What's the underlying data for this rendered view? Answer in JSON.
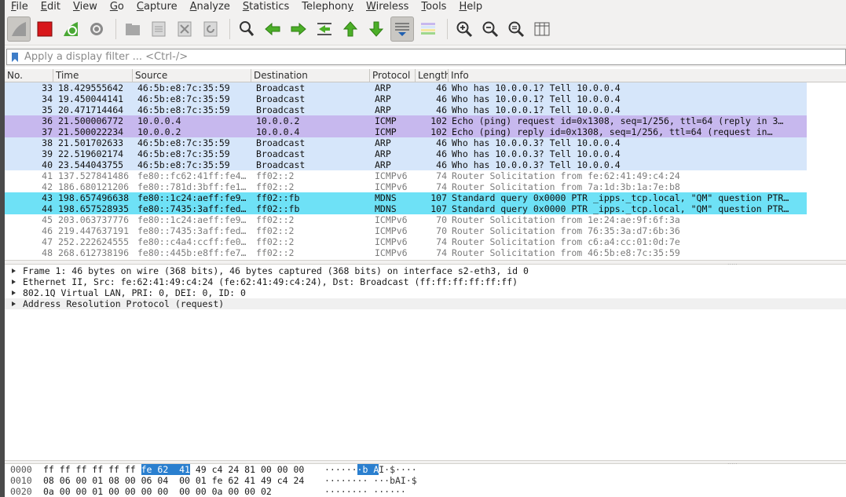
{
  "menu": [
    {
      "pre": "",
      "mn": "F",
      "post": "ile"
    },
    {
      "pre": "",
      "mn": "E",
      "post": "dit"
    },
    {
      "pre": "",
      "mn": "V",
      "post": "iew"
    },
    {
      "pre": "",
      "mn": "G",
      "post": "o"
    },
    {
      "pre": "",
      "mn": "C",
      "post": "apture"
    },
    {
      "pre": "",
      "mn": "A",
      "post": "nalyze"
    },
    {
      "pre": "",
      "mn": "S",
      "post": "tatistics"
    },
    {
      "pre": "Telephon",
      "mn": "y",
      "post": ""
    },
    {
      "pre": "",
      "mn": "W",
      "post": "ireless"
    },
    {
      "pre": "",
      "mn": "T",
      "post": "ools"
    },
    {
      "pre": "",
      "mn": "H",
      "post": "elp"
    }
  ],
  "filter": {
    "placeholder": "Apply a display filter ... <Ctrl-/>"
  },
  "columns": [
    "No.",
    "Time",
    "Source",
    "Destination",
    "Protocol",
    "Length",
    "Info"
  ],
  "colors": {
    "arp": "#d6e6fa",
    "icmp": "#c7b8ee",
    "mdns": "#6ee1f6",
    "white": "#ffffff",
    "grey_text": "#7c7c7c",
    "text": "#111111"
  },
  "packets": [
    {
      "no": "33",
      "time": "18.429555642",
      "src": "46:5b:e8:7c:35:59",
      "dst": "Broadcast",
      "proto": "ARP",
      "len": "46",
      "info": "Who has 10.0.0.1? Tell 10.0.0.4",
      "kind": "arp"
    },
    {
      "no": "34",
      "time": "19.450044141",
      "src": "46:5b:e8:7c:35:59",
      "dst": "Broadcast",
      "proto": "ARP",
      "len": "46",
      "info": "Who has 10.0.0.1? Tell 10.0.0.4",
      "kind": "arp"
    },
    {
      "no": "35",
      "time": "20.471714464",
      "src": "46:5b:e8:7c:35:59",
      "dst": "Broadcast",
      "proto": "ARP",
      "len": "46",
      "info": "Who has 10.0.0.1? Tell 10.0.0.4",
      "kind": "arp"
    },
    {
      "no": "36",
      "time": "21.500006772",
      "src": "10.0.0.4",
      "dst": "10.0.0.2",
      "proto": "ICMP",
      "len": "102",
      "info": "Echo (ping) request  id=0x1308, seq=1/256, ttl=64 (reply in 3…",
      "kind": "icmp"
    },
    {
      "no": "37",
      "time": "21.500022234",
      "src": "10.0.0.2",
      "dst": "10.0.0.4",
      "proto": "ICMP",
      "len": "102",
      "info": "Echo (ping) reply    id=0x1308, seq=1/256, ttl=64 (request in…",
      "kind": "icmp"
    },
    {
      "no": "38",
      "time": "21.501702633",
      "src": "46:5b:e8:7c:35:59",
      "dst": "Broadcast",
      "proto": "ARP",
      "len": "46",
      "info": "Who has 10.0.0.3? Tell 10.0.0.4",
      "kind": "arp"
    },
    {
      "no": "39",
      "time": "22.519602174",
      "src": "46:5b:e8:7c:35:59",
      "dst": "Broadcast",
      "proto": "ARP",
      "len": "46",
      "info": "Who has 10.0.0.3? Tell 10.0.0.4",
      "kind": "arp"
    },
    {
      "no": "40",
      "time": "23.544043755",
      "src": "46:5b:e8:7c:35:59",
      "dst": "Broadcast",
      "proto": "ARP",
      "len": "46",
      "info": "Who has 10.0.0.3? Tell 10.0.0.4",
      "kind": "arp"
    },
    {
      "no": "41",
      "time": "137.527841486",
      "src": "fe80::fc62:41ff:fe4…",
      "dst": "ff02::2",
      "proto": "ICMPv6",
      "len": "74",
      "info": "Router Solicitation from fe:62:41:49:c4:24",
      "kind": "white"
    },
    {
      "no": "42",
      "time": "186.680121206",
      "src": "fe80::781d:3bff:fe1…",
      "dst": "ff02::2",
      "proto": "ICMPv6",
      "len": "74",
      "info": "Router Solicitation from 7a:1d:3b:1a:7e:b8",
      "kind": "white"
    },
    {
      "no": "43",
      "time": "198.657496638",
      "src": "fe80::1c24:aeff:fe9…",
      "dst": "ff02::fb",
      "proto": "MDNS",
      "len": "107",
      "info": "Standard query 0x0000 PTR _ipps._tcp.local, \"QM\" question PTR…",
      "kind": "mdns"
    },
    {
      "no": "44",
      "time": "198.657528935",
      "src": "fe80::7435:3aff:fed…",
      "dst": "ff02::fb",
      "proto": "MDNS",
      "len": "107",
      "info": "Standard query 0x0000 PTR _ipps._tcp.local, \"QM\" question PTR…",
      "kind": "mdns"
    },
    {
      "no": "45",
      "time": "203.063737776",
      "src": "fe80::1c24:aeff:fe9…",
      "dst": "ff02::2",
      "proto": "ICMPv6",
      "len": "70",
      "info": "Router Solicitation from 1e:24:ae:9f:6f:3a",
      "kind": "white"
    },
    {
      "no": "46",
      "time": "219.447637191",
      "src": "fe80::7435:3aff:fed…",
      "dst": "ff02::2",
      "proto": "ICMPv6",
      "len": "70",
      "info": "Router Solicitation from 76:35:3a:d7:6b:36",
      "kind": "white"
    },
    {
      "no": "47",
      "time": "252.222624555",
      "src": "fe80::c4a4:ccff:fe0…",
      "dst": "ff02::2",
      "proto": "ICMPv6",
      "len": "74",
      "info": "Router Solicitation from c6:a4:cc:01:0d:7e",
      "kind": "white"
    },
    {
      "no": "48",
      "time": "268.612738196",
      "src": "fe80::445b:e8ff:fe7…",
      "dst": "ff02::2",
      "proto": "ICMPv6",
      "len": "74",
      "info": "Router Solicitation from 46:5b:e8:7c:35:59",
      "kind": "white"
    }
  ],
  "details": [
    "Frame 1: 46 bytes on wire (368 bits), 46 bytes captured (368 bits) on interface s2-eth3, id 0",
    "Ethernet II, Src: fe:62:41:49:c4:24 (fe:62:41:49:c4:24), Dst: Broadcast (ff:ff:ff:ff:ff:ff)",
    "802.1Q Virtual LAN, PRI: 0, DEI: 0, ID: 0",
    "Address Resolution Protocol (request)"
  ],
  "bytes": [
    {
      "offset": "0000",
      "hex_pre": "ff ff ff ff ff ff ",
      "hex_hl": "fe 62  41",
      "hex_post": " 49 c4 24 81 00 00 00",
      "asc_pre": "······",
      "asc_hl": "·b A",
      "asc_post": "I·$····"
    },
    {
      "offset": "0010",
      "hex_pre": "08 06 00 01 08 00 06 04  00 01 fe 62 41 49 c4 24",
      "hex_hl": "",
      "hex_post": "",
      "asc_pre": "········ ···bAI·$",
      "asc_hl": "",
      "asc_post": ""
    },
    {
      "offset": "0020",
      "hex_pre": "0a 00 00 01 00 00 00 00  00 00 0a 00 00 02",
      "hex_hl": "",
      "hex_post": "",
      "asc_pre": "········ ······",
      "asc_hl": "",
      "asc_post": ""
    }
  ]
}
